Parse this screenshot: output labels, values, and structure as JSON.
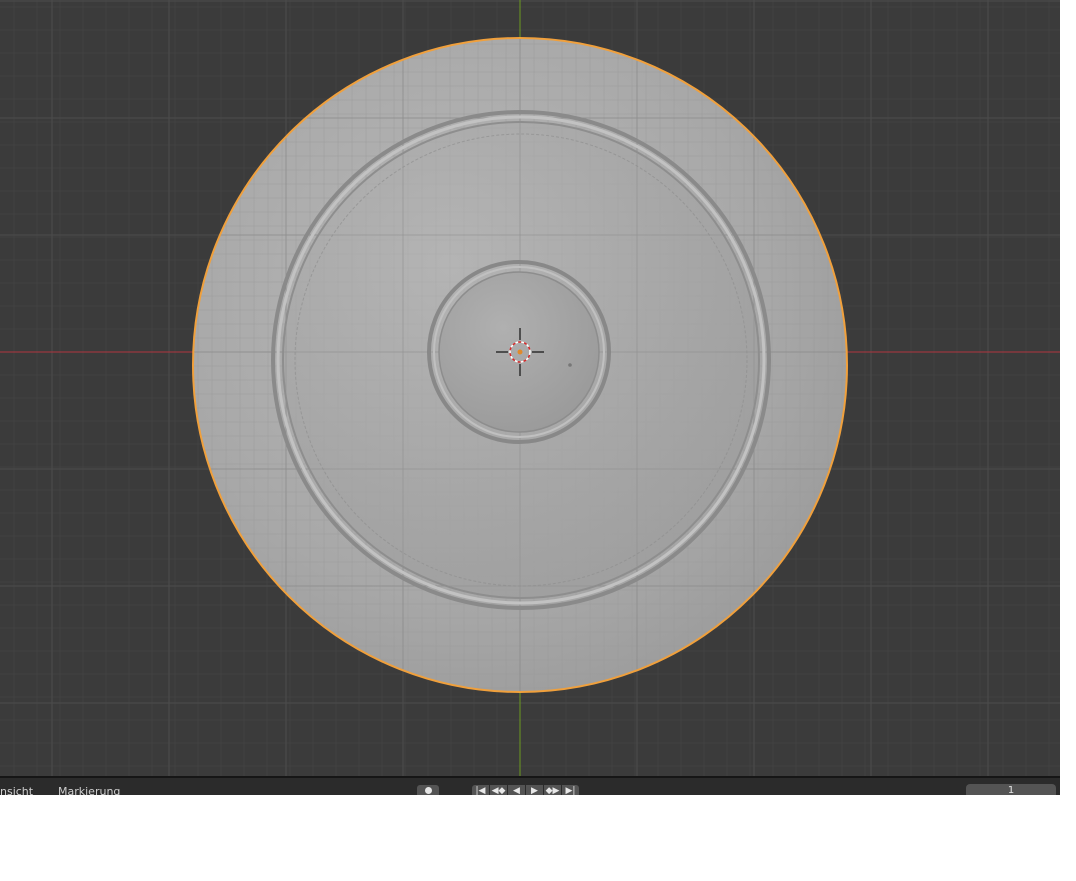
{
  "timeline": {
    "view_label": "nsicht",
    "marker_label": "Markierung",
    "keyframe_icon": "record-dot-icon",
    "playback": {
      "jump_start": "|◀",
      "prev_keyframe": "◀◆",
      "play_reverse": "◀",
      "play": "▶",
      "next_keyframe": "◆▶",
      "jump_end": "▶|"
    },
    "current_frame": "1"
  },
  "colors": {
    "viewport_bg": "#3b3b3b",
    "grid_line": "#474747",
    "x_axis": "#b0353f",
    "y_axis": "#6b9a1f",
    "selection_outline": "#f0a03c",
    "mesh_fill": "#ababab",
    "timeline_bg": "#2b2b2b"
  }
}
